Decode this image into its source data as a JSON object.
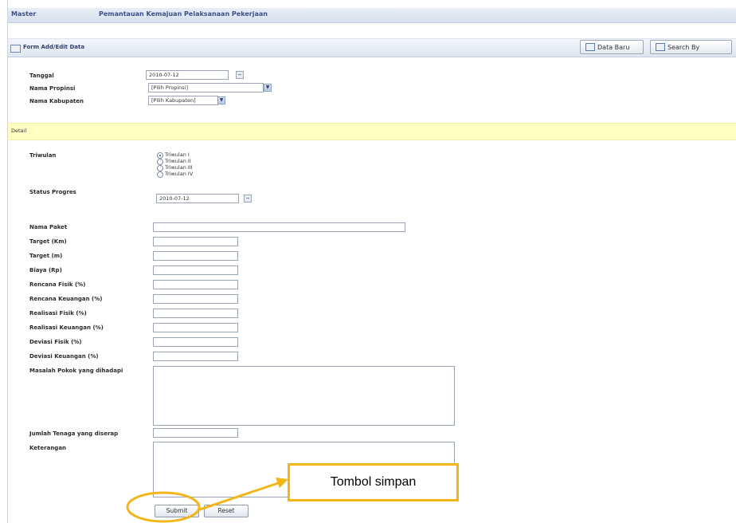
{
  "header": {
    "menu_label": "Master",
    "title": "Pemantauan Kemajuan Pelaksanaan Pekerjaan"
  },
  "toolbar": {
    "form_title": "Form Add/Edit Data",
    "new_data_label": "Data Baru",
    "search_label": "Search By"
  },
  "top_fields": {
    "tanggal": {
      "label": "Tanggal",
      "value": "2010-07-12"
    },
    "propinsi": {
      "label": "Nama Propinsi",
      "value": "[Pilih Propinsi]"
    },
    "kabupaten": {
      "label": "Nama Kabupaten",
      "value": "[Pilih Kabupaten]"
    }
  },
  "detail": {
    "section_label": "Detail",
    "triwulan": {
      "label": "Triwulan",
      "options": [
        "Triwulan I",
        "Triwulan II",
        "Triwulan III",
        "Triwulan IV"
      ],
      "selected": 0
    },
    "status_progres": {
      "label": "Status Progres",
      "value": "2010-07-12"
    },
    "fields": [
      {
        "label": "Nama Paket",
        "value": ""
      },
      {
        "label": "Target (Km)",
        "value": ""
      },
      {
        "label": "Target (m)",
        "value": ""
      },
      {
        "label": "Biaya (Rp)",
        "value": ""
      },
      {
        "label": "Rencana Fisik (%)",
        "value": ""
      },
      {
        "label": "Rencana Keuangan (%)",
        "value": ""
      },
      {
        "label": "Realisasi Fisik (%)",
        "value": ""
      },
      {
        "label": "Realisasi Keuangan (%)",
        "value": ""
      },
      {
        "label": "Deviasi Fisik (%)",
        "value": ""
      },
      {
        "label": "Deviasi Keuangan (%)",
        "value": ""
      }
    ],
    "masalah": {
      "label": "Masalah Pokok yang dihadapi",
      "value": ""
    },
    "tenaga": {
      "label": "Jumlah Tenaga yang diserap",
      "value": ""
    },
    "keterangan": {
      "label": "Keterangan",
      "value": ""
    }
  },
  "buttons": {
    "submit": "Submit",
    "reset": "Reset"
  },
  "annotation": {
    "callout_text": "Tombol simpan",
    "highlight_color": "#f2b619"
  }
}
